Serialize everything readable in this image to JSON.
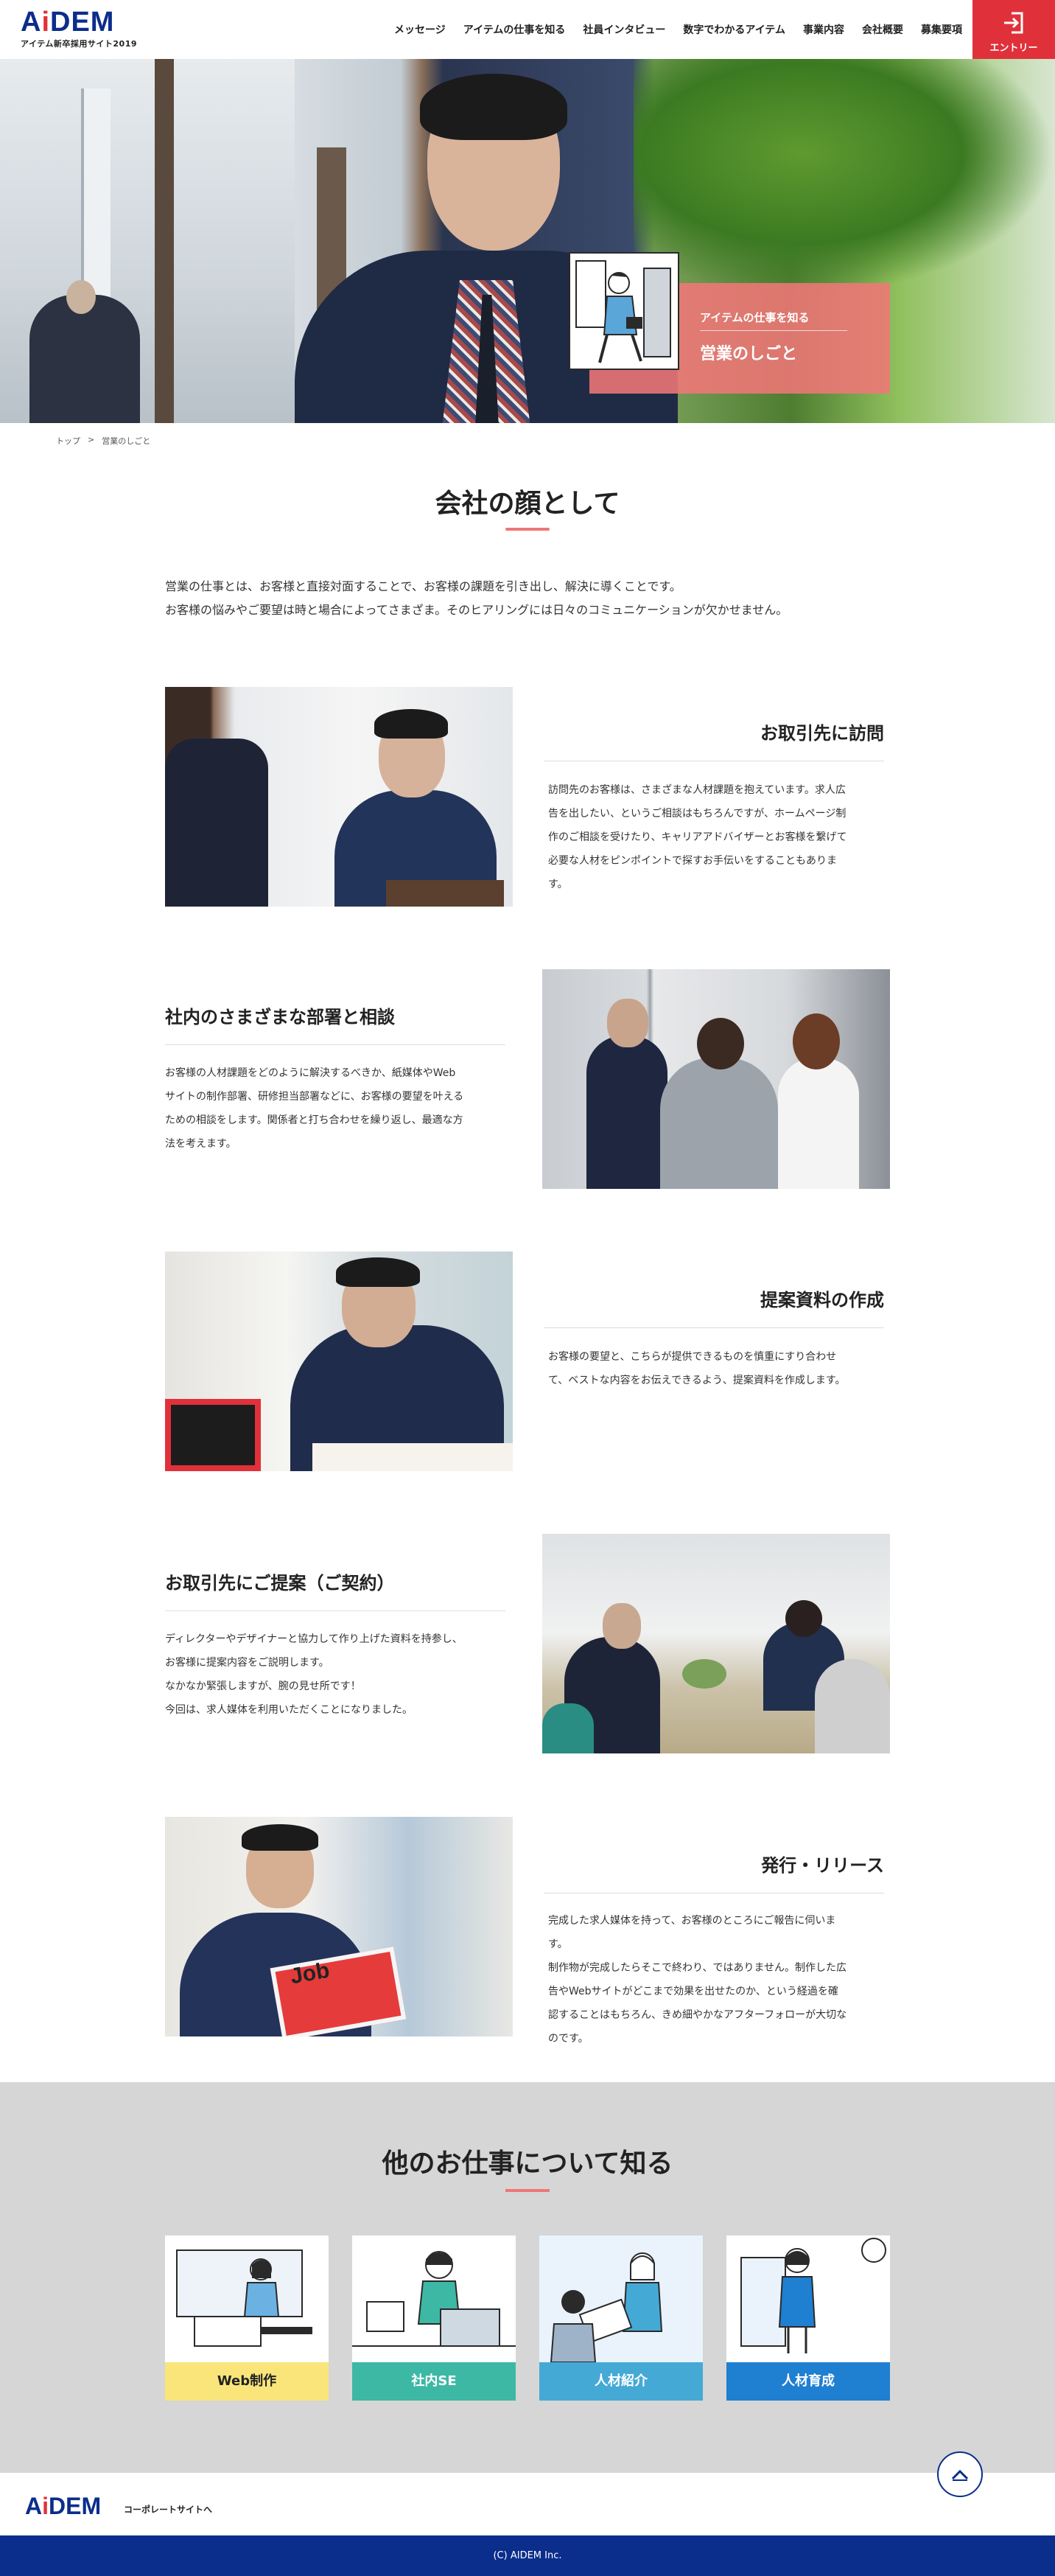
{
  "header": {
    "logo": "AIDEM",
    "logo_sub": "アイテム新卒採用サイト2019",
    "nav": [
      "メッセージ",
      "アイテムの仕事を知る",
      "社員インタビュー",
      "数字でわかるアイテム",
      "事業内容",
      "会社概要",
      "募集要項"
    ],
    "entry_label": "エントリー",
    "entry_icon": "login-arrow-icon"
  },
  "hero": {
    "kicker": "アイテムの仕事を知る",
    "title": "営業のしごと"
  },
  "breadcrumb": {
    "home": "トップ",
    "sep": ">",
    "current": "営業のしごと"
  },
  "intro": {
    "title": "会社の顔として",
    "lines": [
      "営業の仕事とは、お客様と直接対面することで、お客様の課題を引き出し、解決に導くことです。",
      "お客様の悩みやご要望は時と場合によってさまざま。そのヒアリングには日々のコミュニケーションが欠かせません。"
    ]
  },
  "blocks": [
    {
      "title": "お取引先に訪問",
      "text": [
        "訪問先のお客様は、さまざまな人材課題を抱えています。求人広",
        "告を出したい、というご相談はもちろんですが、ホームページ制",
        "作のご相談を受けたり、キャリアアドバイザーとお客様を繋げて",
        "必要な人材をピンポイントで探すお手伝いをすることもありま",
        "す。"
      ]
    },
    {
      "title": "社内のさまざまな部署と相談",
      "text": [
        "お客様の人材課題をどのように解決するべきか、紙媒体やWeb",
        "サイトの制作部署、研修担当部署などに、お客様の要望を叶える",
        "ための相談をします。関係者と打ち合わせを繰り返し、最適な方",
        "法を考えます。"
      ]
    },
    {
      "title": "提案資料の作成",
      "text": [
        "お客様の要望と、こちらが提供できるものを慎重にすり合わせ",
        "て、ベストな内容をお伝えできるよう、提案資料を作成します。"
      ]
    },
    {
      "title": "お取引先にご提案（ご契約）",
      "text": [
        "ディレクターやデザイナーと協力して作り上げた資料を持参し、",
        "お客様に提案内容をご説明します。",
        "なかなか緊張しますが、腕の見せ所です！",
        "今回は、求人媒体を利用いただくことになりました。"
      ]
    },
    {
      "title": "発行・リリース",
      "text": [
        "完成した求人媒体を持って、お客様のところにご報告に伺いま",
        "す。",
        "制作物が完成したらそこで終わり、ではありません。制作した広",
        "告やWebサイトがどこまで効果を出せたのか、という経過を確",
        "認することはもちろん、きめ細やかなアフターフォローが大切な",
        "のです。"
      ]
    }
  ],
  "other": {
    "title": "他のお仕事について知る",
    "jobs": [
      {
        "label": "Web制作",
        "color": "#f9e57a",
        "text_color": "#222"
      },
      {
        "label": "社内SE",
        "color": "#3db8a5",
        "text_color": "#fff"
      },
      {
        "label": "人材紹介",
        "color": "#45a9d6",
        "text_color": "#fff"
      },
      {
        "label": "人材育成",
        "color": "#1f7fd0",
        "text_color": "#fff"
      }
    ]
  },
  "footer": {
    "logo": "AIDEM",
    "link": "コーポレートサイトへ",
    "copyright": "(C) AIDEM Inc.",
    "pagetop_icon": "chevron-up-icon"
  },
  "colors": {
    "brand_blue": "#0b2d8c",
    "brand_red": "#e0313b",
    "accent_pink": "#f07678"
  }
}
